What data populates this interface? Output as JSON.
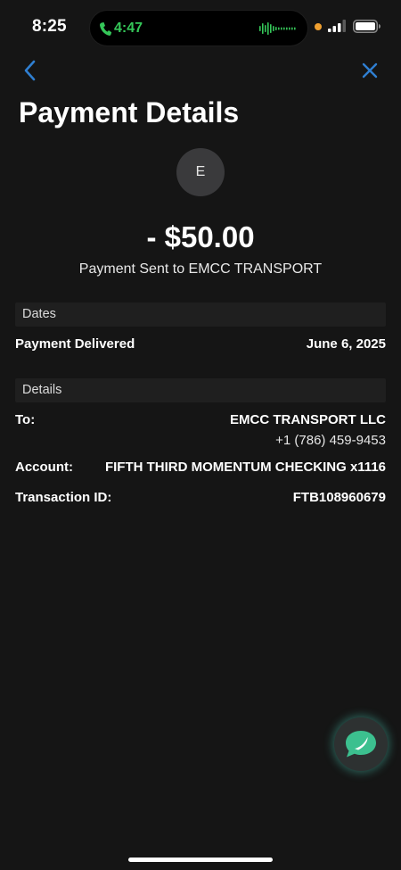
{
  "status_bar": {
    "time": "8:25",
    "call_time": "4:47"
  },
  "header": {
    "title": "Payment Details"
  },
  "payee": {
    "initial": "E"
  },
  "amount": {
    "value": "- $50.00",
    "description": "Payment Sent to EMCC TRANSPORT"
  },
  "dates": {
    "header": "Dates",
    "delivered_label": "Payment Delivered",
    "delivered_value": "June 6, 2025"
  },
  "details": {
    "header": "Details",
    "to_label": "To:",
    "to_name": "EMCC TRANSPORT LLC",
    "to_phone": "+1 (786) 459-9453",
    "account_label": "Account:",
    "account_value": "FIFTH THIRD MOMENTUM CHECKING x1116",
    "transaction_label": "Transaction ID:",
    "transaction_value": "FTB108960679"
  },
  "colors": {
    "accent_blue": "#2f7fd1",
    "call_green": "#35c759",
    "chat_green": "#3cc08f",
    "background": "#151515"
  },
  "icons": {
    "back": "chevron-left-icon",
    "close": "close-icon",
    "chat": "chat-bubble-icon"
  }
}
